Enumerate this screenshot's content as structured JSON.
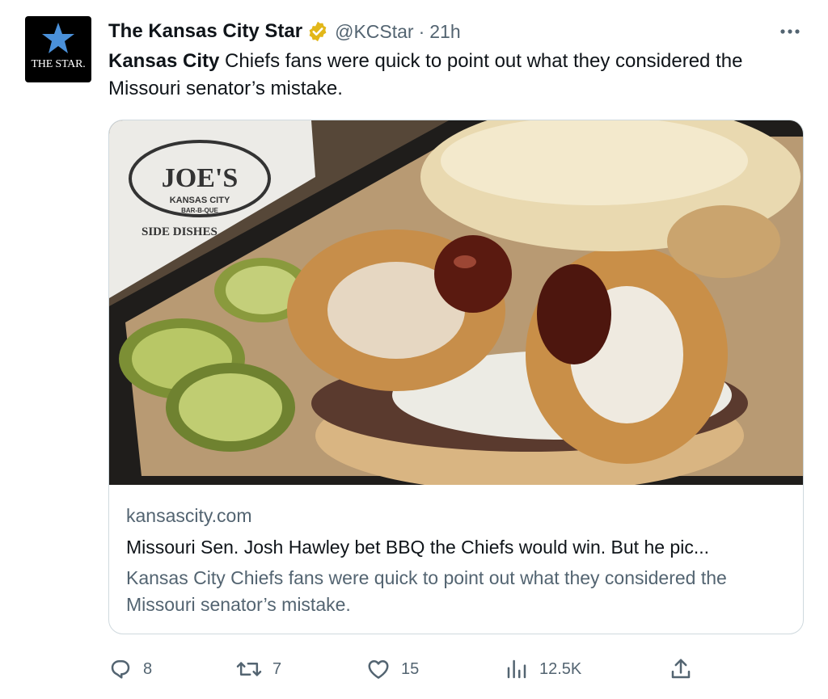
{
  "tweet": {
    "avatar_text": "THE STAR.",
    "display_name": "The Kansas City Star",
    "handle": "@KCStar",
    "separator": "·",
    "time": "21h",
    "text_bold": "Kansas City",
    "text_rest": " Chiefs fans were quick to point out what they considered the Missouri senator’s mistake."
  },
  "card": {
    "domain": "kansascity.com",
    "title": "Missouri Sen. Josh Hawley bet BBQ the Chiefs would win. But he pic...",
    "description": "Kansas City Chiefs fans were quick to point out what they considered the Missouri senator’s mistake.",
    "image_sign_text": "JOE'S",
    "image_sign_sub": "KANSAS CITY",
    "image_sign_sub2": "BAR-B-QUE",
    "image_side_text": "SIDE DISHES"
  },
  "actions": {
    "replies": "8",
    "reposts": "7",
    "likes": "15",
    "views": "12.5K"
  },
  "icons": {
    "more": "more-icon",
    "verified": "verified-badge-icon",
    "reply": "reply-icon",
    "repost": "repost-icon",
    "like": "heart-icon",
    "views": "views-icon",
    "share": "share-icon"
  },
  "colors": {
    "text": "#0f1419",
    "secondary": "#536471",
    "verified_gold": "#e2b719",
    "border": "#cfd9de",
    "star_blue": "#4a90d9"
  }
}
